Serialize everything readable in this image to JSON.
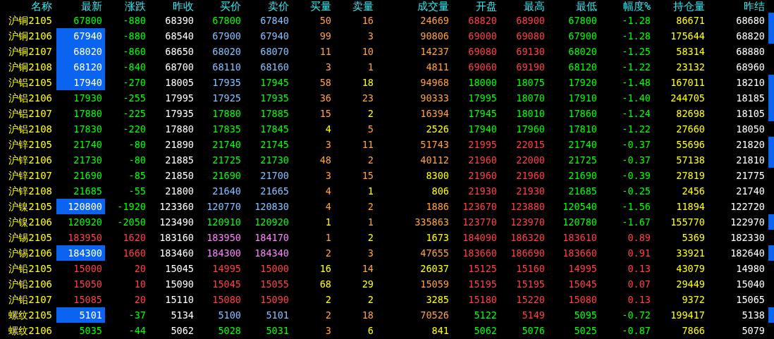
{
  "table": {
    "columns": [
      "名称",
      "最新",
      "涨跌",
      "昨收",
      "买价",
      "卖价",
      "买量",
      "卖量",
      "成交量",
      "开盘",
      "最高",
      "最低",
      "幅度%",
      "持仓量",
      "昨结"
    ],
    "rows": [
      {
        "highlighted": false,
        "flagged": true,
        "cells": [
          "沪铜2105",
          {
            "text": "67800",
            "color": "#00ff00"
          },
          {
            "text": "-880",
            "color": "#00ff00"
          },
          "68390",
          {
            "text": "67800",
            "color": "#00ff00"
          },
          {
            "text": "67840",
            "color": "#80c0ff"
          },
          {
            "text": "50",
            "color": "#ffa040"
          },
          {
            "text": "16",
            "color": "#ffa040"
          },
          {
            "text": "24669",
            "color": "#ffa040"
          },
          {
            "text": "68820",
            "color": "#ff4040"
          },
          {
            "text": "68900",
            "color": "#ff4040"
          },
          {
            "text": "67800",
            "color": "#00ff00"
          },
          {
            "text": "-1.28",
            "color": "#00ff00"
          },
          "86671",
          "68680"
        ]
      },
      {
        "highlighted": true,
        "flagged": true,
        "cells": [
          "沪铜2106",
          "67940",
          {
            "text": "-880",
            "color": "#00ff00"
          },
          "68540",
          {
            "text": "67900",
            "color": "#80c0ff"
          },
          {
            "text": "67940",
            "color": "#80c0ff"
          },
          {
            "text": "99",
            "color": "#ffa040"
          },
          {
            "text": "3",
            "color": "#ffa040"
          },
          {
            "text": "90806",
            "color": "#ffa040"
          },
          {
            "text": "69000",
            "color": "#ff4040"
          },
          {
            "text": "69080",
            "color": "#ff4040"
          },
          {
            "text": "67900",
            "color": "#00ff00"
          },
          {
            "text": "-1.28",
            "color": "#00ff00"
          },
          "175644",
          "68820"
        ]
      },
      {
        "highlighted": true,
        "flagged": false,
        "cells": [
          "沪铜2107",
          "68020",
          {
            "text": "-860",
            "color": "#00ff00"
          },
          "68650",
          {
            "text": "68020",
            "color": "#80c0ff"
          },
          {
            "text": "68070",
            "color": "#80c0ff"
          },
          {
            "text": "11",
            "color": "#ffa040"
          },
          {
            "text": "10",
            "color": "#ffa040"
          },
          {
            "text": "14237",
            "color": "#ffa040"
          },
          {
            "text": "69080",
            "color": "#ff4040"
          },
          {
            "text": "69130",
            "color": "#ff4040"
          },
          {
            "text": "68020",
            "color": "#00ff00"
          },
          {
            "text": "-1.25",
            "color": "#00ff00"
          },
          "58314",
          "68880"
        ]
      },
      {
        "highlighted": true,
        "flagged": false,
        "cells": [
          "沪铜2108",
          "68120",
          {
            "text": "-840",
            "color": "#00ff00"
          },
          "68700",
          {
            "text": "68110",
            "color": "#80c0ff"
          },
          {
            "text": "68160",
            "color": "#80c0ff"
          },
          {
            "text": "3",
            "color": "#ffa040"
          },
          {
            "text": "1",
            "color": "#ffa040"
          },
          {
            "text": "4811",
            "color": "#ffa040"
          },
          {
            "text": "69060",
            "color": "#ff4040"
          },
          {
            "text": "69190",
            "color": "#ff4040"
          },
          {
            "text": "68120",
            "color": "#00ff00"
          },
          {
            "text": "-1.22",
            "color": "#00ff00"
          },
          "23132",
          "68960"
        ]
      },
      {
        "highlighted": true,
        "flagged": true,
        "cells": [
          "沪铝2105",
          "17940",
          {
            "text": "-270",
            "color": "#00ff00"
          },
          "18005",
          {
            "text": "17935",
            "color": "#80c0ff"
          },
          {
            "text": "17945",
            "color": "#00ff00"
          },
          {
            "text": "58",
            "color": "#ffa040"
          },
          {
            "text": "18",
            "color": "#ffff00"
          },
          {
            "text": "94968",
            "color": "#ffa040"
          },
          {
            "text": "18000",
            "color": "#00ff00"
          },
          {
            "text": "18075",
            "color": "#00ff00"
          },
          {
            "text": "17920",
            "color": "#00ff00"
          },
          {
            "text": "-1.48",
            "color": "#00ff00"
          },
          "167011",
          "18210"
        ]
      },
      {
        "highlighted": false,
        "flagged": true,
        "cells": [
          "沪铝2106",
          {
            "text": "17930",
            "color": "#00ff00"
          },
          {
            "text": "-255",
            "color": "#00ff00"
          },
          "17995",
          {
            "text": "17925",
            "color": "#80c0ff"
          },
          {
            "text": "17935",
            "color": "#00ff00"
          },
          {
            "text": "36",
            "color": "#ffa040"
          },
          {
            "text": "23",
            "color": "#ffa040"
          },
          {
            "text": "90333",
            "color": "#ffa040"
          },
          {
            "text": "17995",
            "color": "#00ff00"
          },
          {
            "text": "18070",
            "color": "#00ff00"
          },
          {
            "text": "17910",
            "color": "#00ff00"
          },
          {
            "text": "-1.40",
            "color": "#00ff00"
          },
          "244705",
          "18185"
        ]
      },
      {
        "highlighted": false,
        "flagged": true,
        "cells": [
          "沪铝2107",
          {
            "text": "17880",
            "color": "#00ff00"
          },
          {
            "text": "-225",
            "color": "#00ff00"
          },
          "17935",
          {
            "text": "17880",
            "color": "#00ff00"
          },
          {
            "text": "17885",
            "color": "#00ff00"
          },
          {
            "text": "15",
            "color": "#ffa040"
          },
          {
            "text": "2",
            "color": "#ffff00"
          },
          {
            "text": "16394",
            "color": "#ffa040"
          },
          {
            "text": "17945",
            "color": "#00ff00"
          },
          {
            "text": "18010",
            "color": "#00ff00"
          },
          {
            "text": "17860",
            "color": "#00ff00"
          },
          {
            "text": "-1.24",
            "color": "#00ff00"
          },
          "82698",
          "18105"
        ]
      },
      {
        "highlighted": false,
        "flagged": false,
        "cells": [
          "沪铝2108",
          {
            "text": "17830",
            "color": "#00ff00"
          },
          {
            "text": "-220",
            "color": "#00ff00"
          },
          "17880",
          {
            "text": "17835",
            "color": "#00ff00"
          },
          {
            "text": "17845",
            "color": "#00ff00"
          },
          {
            "text": "4",
            "color": "#ffff00"
          },
          {
            "text": "5",
            "color": "#ffa040"
          },
          {
            "text": "2526",
            "color": "#ffff00"
          },
          {
            "text": "17940",
            "color": "#00ff00"
          },
          {
            "text": "17960",
            "color": "#00ff00"
          },
          {
            "text": "17810",
            "color": "#00ff00"
          },
          {
            "text": "-1.22",
            "color": "#00ff00"
          },
          "27660",
          "18050"
        ]
      },
      {
        "highlighted": false,
        "flagged": true,
        "cells": [
          "沪锌2105",
          {
            "text": "21740",
            "color": "#00ff00"
          },
          {
            "text": "-80",
            "color": "#00ff00"
          },
          "21890",
          {
            "text": "21740",
            "color": "#00ff00"
          },
          {
            "text": "21745",
            "color": "#00ff00"
          },
          {
            "text": "3",
            "color": "#ffa040"
          },
          {
            "text": "11",
            "color": "#ffa040"
          },
          {
            "text": "51743",
            "color": "#ffa040"
          },
          {
            "text": "21995",
            "color": "#ff4040"
          },
          {
            "text": "22015",
            "color": "#ff4040"
          },
          {
            "text": "21740",
            "color": "#00ff00"
          },
          {
            "text": "-0.37",
            "color": "#00ff00"
          },
          "55696",
          "21820"
        ]
      },
      {
        "highlighted": false,
        "flagged": true,
        "cells": [
          "沪锌2106",
          {
            "text": "21730",
            "color": "#00ff00"
          },
          {
            "text": "-80",
            "color": "#00ff00"
          },
          "21885",
          {
            "text": "21725",
            "color": "#00ff00"
          },
          {
            "text": "21730",
            "color": "#00ff00"
          },
          {
            "text": "48",
            "color": "#ffa040"
          },
          {
            "text": "2",
            "color": "#ffa040"
          },
          {
            "text": "40112",
            "color": "#ffa040"
          },
          {
            "text": "21960",
            "color": "#ff4040"
          },
          {
            "text": "22000",
            "color": "#ff4040"
          },
          {
            "text": "21725",
            "color": "#00ff00"
          },
          {
            "text": "-0.37",
            "color": "#00ff00"
          },
          "57138",
          "21810"
        ]
      },
      {
        "highlighted": false,
        "flagged": false,
        "cells": [
          "沪锌2107",
          {
            "text": "21690",
            "color": "#00ff00"
          },
          {
            "text": "-85",
            "color": "#00ff00"
          },
          "21850",
          {
            "text": "21690",
            "color": "#00ff00"
          },
          {
            "text": "21700",
            "color": "#80c0ff"
          },
          {
            "text": "3",
            "color": "#ffa040"
          },
          {
            "text": "15",
            "color": "#ffa040"
          },
          {
            "text": "8300",
            "color": "#ffff00"
          },
          {
            "text": "21960",
            "color": "#ff4040"
          },
          {
            "text": "21960",
            "color": "#ff4040"
          },
          {
            "text": "21690",
            "color": "#00ff00"
          },
          {
            "text": "-0.39",
            "color": "#00ff00"
          },
          "27819",
          "21775"
        ]
      },
      {
        "highlighted": false,
        "flagged": false,
        "cells": [
          "沪锌2108",
          {
            "text": "21685",
            "color": "#00ff00"
          },
          {
            "text": "-55",
            "color": "#00ff00"
          },
          "21800",
          {
            "text": "21640",
            "color": "#80c0ff"
          },
          {
            "text": "21665",
            "color": "#80c0ff"
          },
          {
            "text": "4",
            "color": "#ffa040"
          },
          {
            "text": "1",
            "color": "#ffff00"
          },
          {
            "text": "806",
            "color": "#ffff00"
          },
          {
            "text": "21930",
            "color": "#ff4040"
          },
          {
            "text": "21930",
            "color": "#ff4040"
          },
          {
            "text": "21685",
            "color": "#00ff00"
          },
          {
            "text": "-0.25",
            "color": "#00ff00"
          },
          "2456",
          "21740"
        ]
      },
      {
        "highlighted": true,
        "flagged": false,
        "cells": [
          "沪镍2105",
          "120800",
          {
            "text": "-1920",
            "color": "#00ff00"
          },
          "123360",
          {
            "text": "120770",
            "color": "#80c0ff"
          },
          {
            "text": "120830",
            "color": "#80c0ff"
          },
          {
            "text": "4",
            "color": "#ffa040"
          },
          {
            "text": "2",
            "color": "#ffa040"
          },
          {
            "text": "1886",
            "color": "#ffa040"
          },
          {
            "text": "123670",
            "color": "#ff4040"
          },
          {
            "text": "123880",
            "color": "#ff4040"
          },
          {
            "text": "120540",
            "color": "#00ff00"
          },
          {
            "text": "-1.56",
            "color": "#00ff00"
          },
          "11894",
          "122720"
        ]
      },
      {
        "highlighted": false,
        "flagged": true,
        "cells": [
          "沪镍2106",
          {
            "text": "120920",
            "color": "#00ff00"
          },
          {
            "text": "-2050",
            "color": "#00ff00"
          },
          "123490",
          {
            "text": "120910",
            "color": "#00ff00"
          },
          {
            "text": "120920",
            "color": "#00ff00"
          },
          {
            "text": "1",
            "color": "#ffff00"
          },
          {
            "text": "1",
            "color": "#ffa040"
          },
          {
            "text": "335863",
            "color": "#ffa040"
          },
          {
            "text": "123770",
            "color": "#ff4040"
          },
          {
            "text": "123970",
            "color": "#ff4040"
          },
          {
            "text": "120780",
            "color": "#00ff00"
          },
          {
            "text": "-1.67",
            "color": "#00ff00"
          },
          "155770",
          "122970"
        ]
      },
      {
        "highlighted": false,
        "flagged": false,
        "cells": [
          "沪锡2105",
          {
            "text": "183950",
            "color": "#ff4040"
          },
          {
            "text": "1620",
            "color": "#ff4040"
          },
          "183160",
          {
            "text": "183950",
            "color": "#ff80ff"
          },
          {
            "text": "184170",
            "color": "#ff80ff"
          },
          {
            "text": "1",
            "color": "#ffa040"
          },
          {
            "text": "2",
            "color": "#ffff00"
          },
          {
            "text": "1673",
            "color": "#ffff00"
          },
          {
            "text": "184090",
            "color": "#ff4040"
          },
          {
            "text": "186320",
            "color": "#ff4040"
          },
          {
            "text": "183610",
            "color": "#ff4040"
          },
          {
            "text": "0.89",
            "color": "#ff4040"
          },
          "5369",
          "182330"
        ]
      },
      {
        "highlighted": true,
        "flagged": true,
        "cells": [
          "沪锡2106",
          "184300",
          {
            "text": "1660",
            "color": "#ff4040"
          },
          "183460",
          {
            "text": "184300",
            "color": "#ff80ff"
          },
          {
            "text": "184340",
            "color": "#ff80ff"
          },
          {
            "text": "2",
            "color": "#ffa040"
          },
          {
            "text": "3",
            "color": "#ffa040"
          },
          {
            "text": "47655",
            "color": "#ffa040"
          },
          {
            "text": "183660",
            "color": "#ff4040"
          },
          {
            "text": "186690",
            "color": "#ff4040"
          },
          {
            "text": "183660",
            "color": "#ff4040"
          },
          {
            "text": "0.91",
            "color": "#ff4040"
          },
          "33921",
          "182640"
        ]
      },
      {
        "highlighted": false,
        "flagged": false,
        "cells": [
          "沪铅2105",
          {
            "text": "15000",
            "color": "#ff4040"
          },
          {
            "text": "20",
            "color": "#ff4040"
          },
          "15045",
          {
            "text": "14995",
            "color": "#ff4040"
          },
          {
            "text": "15000",
            "color": "#ff4040"
          },
          {
            "text": "16",
            "color": "#ffff00"
          },
          {
            "text": "14",
            "color": "#ffa040"
          },
          {
            "text": "26037",
            "color": "#ffff00"
          },
          {
            "text": "15125",
            "color": "#ff4040"
          },
          {
            "text": "15160",
            "color": "#ff4040"
          },
          {
            "text": "14995",
            "color": "#ff4040"
          },
          {
            "text": "0.13",
            "color": "#ff4040"
          },
          "43079",
          "14980"
        ]
      },
      {
        "highlighted": false,
        "flagged": false,
        "cells": [
          "沪铅2106",
          {
            "text": "15050",
            "color": "#ff4040"
          },
          {
            "text": "10",
            "color": "#ff4040"
          },
          "15090",
          {
            "text": "15045",
            "color": "#ff4040"
          },
          {
            "text": "15055",
            "color": "#ff4040"
          },
          {
            "text": "68",
            "color": "#ffff00"
          },
          {
            "text": "29",
            "color": "#ffff00"
          },
          {
            "text": "15059",
            "color": "#ffa040"
          },
          {
            "text": "15195",
            "color": "#ff4040"
          },
          {
            "text": "15195",
            "color": "#ff4040"
          },
          {
            "text": "15045",
            "color": "#ff4040"
          },
          {
            "text": "0.07",
            "color": "#ff4040"
          },
          "29449",
          "15040"
        ]
      },
      {
        "highlighted": false,
        "flagged": false,
        "cells": [
          "沪铅2107",
          {
            "text": "15085",
            "color": "#ff4040"
          },
          {
            "text": "20",
            "color": "#ff4040"
          },
          "15110",
          {
            "text": "15080",
            "color": "#ff4040"
          },
          {
            "text": "15090",
            "color": "#ff4040"
          },
          {
            "text": "2",
            "color": "#ffff00"
          },
          {
            "text": "2",
            "color": "#ffff00"
          },
          {
            "text": "3285",
            "color": "#ffff00"
          },
          {
            "text": "15180",
            "color": "#ff4040"
          },
          {
            "text": "15220",
            "color": "#ff4040"
          },
          {
            "text": "15080",
            "color": "#ff4040"
          },
          {
            "text": "0.13",
            "color": "#ff4040"
          },
          "9372",
          "15065"
        ]
      },
      {
        "highlighted": true,
        "flagged": true,
        "cells": [
          "螺纹2105",
          "5101",
          {
            "text": "-37",
            "color": "#00ff00"
          },
          "5134",
          {
            "text": "5100",
            "color": "#80c0ff"
          },
          {
            "text": "5101",
            "color": "#80c0ff"
          },
          {
            "text": "2",
            "color": "#ffa040"
          },
          {
            "text": "18",
            "color": "#ffa040"
          },
          {
            "text": "70526",
            "color": "#ffa040"
          },
          {
            "text": "5122",
            "color": "#00ff00"
          },
          {
            "text": "5149",
            "color": "#ff4040"
          },
          {
            "text": "5095",
            "color": "#00ff00"
          },
          {
            "text": "-0.72",
            "color": "#00ff00"
          },
          "199417",
          "5138"
        ]
      },
      {
        "highlighted": false,
        "flagged": false,
        "cells": [
          "螺纹2106",
          {
            "text": "5035",
            "color": "#00ff00"
          },
          {
            "text": "-44",
            "color": "#00ff00"
          },
          "5062",
          {
            "text": "5028",
            "color": "#00ff00"
          },
          {
            "text": "5031",
            "color": "#00ff00"
          },
          {
            "text": "3",
            "color": "#ffa040"
          },
          {
            "text": "6",
            "color": "#ffff00"
          },
          {
            "text": "841",
            "color": "#ffff00"
          },
          {
            "text": "5062",
            "color": "#00ff00"
          },
          {
            "text": "5076",
            "color": "#00ff00"
          },
          {
            "text": "5025",
            "color": "#00ff00"
          },
          {
            "text": "-0.87",
            "color": "#00ff00"
          },
          "7866",
          "5079"
        ]
      }
    ]
  }
}
